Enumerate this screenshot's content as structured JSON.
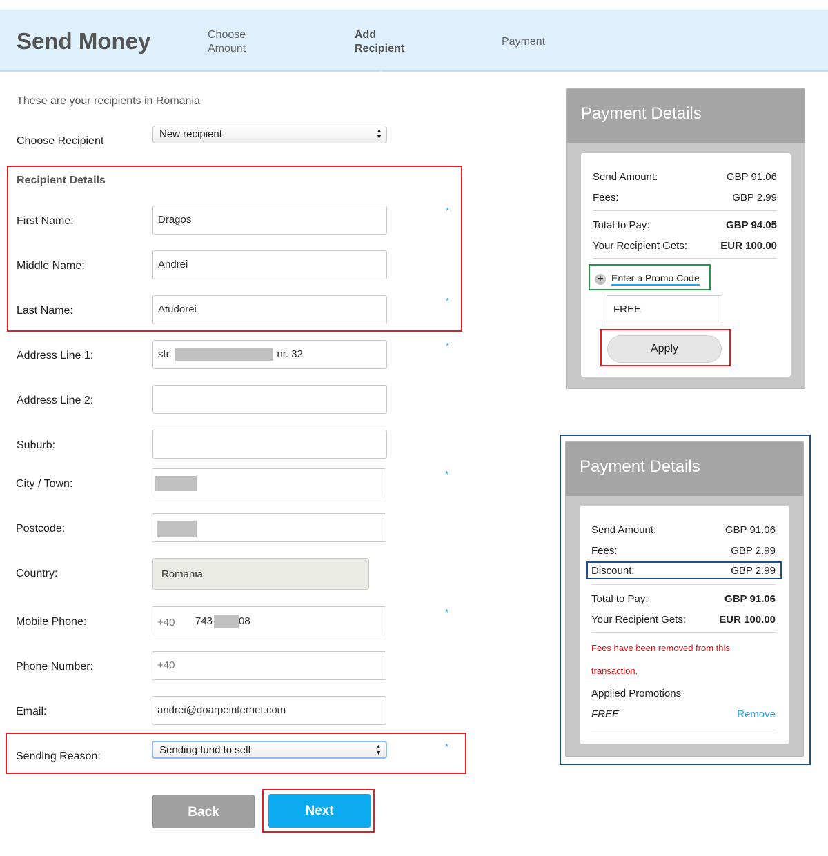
{
  "header": {
    "title": "Send Money",
    "steps": [
      {
        "line1": "Choose",
        "line2": "Amount"
      },
      {
        "line1": "Add",
        "line2": "Recipient"
      },
      {
        "line1": "Payment",
        "line2": ""
      }
    ],
    "active_step": 1
  },
  "form": {
    "intro": "These are your recipients in Romania",
    "choose_recipient": {
      "label": "Choose Recipient",
      "value": "New recipient"
    },
    "section_title": "Recipient Details",
    "first_name": {
      "label": "First Name:",
      "value": "Dragos"
    },
    "middle_name": {
      "label": "Middle Name:",
      "value": "Andrei"
    },
    "last_name": {
      "label": "Last Name:",
      "value": "Atudorei"
    },
    "address1": {
      "label": "Address Line 1:",
      "prefix": "str.",
      "suffix": "nr. 32"
    },
    "address2": {
      "label": "Address Line 2:",
      "value": ""
    },
    "suburb": {
      "label": "Suburb:",
      "value": ""
    },
    "city": {
      "label": "City / Town:"
    },
    "postcode": {
      "label": "Postcode:"
    },
    "country": {
      "label": "Country:",
      "value": "Romania"
    },
    "mobile": {
      "label": "Mobile Phone:",
      "code": "+40",
      "prefix": "743",
      "suffix": "08"
    },
    "phone": {
      "label": "Phone Number:",
      "code": "+40"
    },
    "email": {
      "label": "Email:",
      "value": "andrei@doarpeinternet.com"
    },
    "reason": {
      "label": "Sending Reason:",
      "value": "Sending fund to self"
    },
    "required_marker": "*",
    "back_label": "Back",
    "next_label": "Next"
  },
  "payment_before": {
    "title": "Payment Details",
    "send_amount": {
      "label": "Send Amount:",
      "value": "GBP 91.06"
    },
    "fees": {
      "label": "Fees:",
      "value": "GBP 2.99"
    },
    "total": {
      "label": "Total to Pay:",
      "value": "GBP 94.05"
    },
    "gets": {
      "label": "Your Recipient Gets:",
      "value": "EUR 100.00"
    },
    "promo_link": "Enter a Promo Code",
    "promo_value": "FREE",
    "apply_label": "Apply"
  },
  "payment_after": {
    "title": "Payment Details",
    "send_amount": {
      "label": "Send Amount:",
      "value": "GBP 91.06"
    },
    "fees": {
      "label": "Fees:",
      "value": "GBP 2.99"
    },
    "discount": {
      "label": "Discount:",
      "value": "GBP 2.99"
    },
    "total": {
      "label": "Total to Pay:",
      "value": "GBP 91.06"
    },
    "gets": {
      "label": "Your Recipient Gets:",
      "value": "EUR 100.00"
    },
    "note_line1": "Fees have been removed from this",
    "note_line2": "transaction.",
    "applied_title": "Applied Promotions",
    "promo_name": "FREE",
    "remove_label": "Remove"
  },
  "colors": {
    "accent": "#0aabef",
    "header_bg": "#def0fc",
    "highlight_red": "#e21e26",
    "highlight_green": "#1c9a45",
    "highlight_blue": "#1d4f93",
    "note_red": "#e01010"
  },
  "icons": {
    "promo": "plus-circle-icon",
    "select": "select-arrows-icon"
  }
}
